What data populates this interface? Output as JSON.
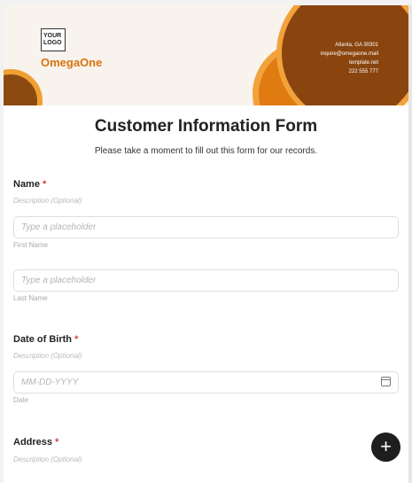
{
  "header": {
    "logo_text": "YOUR LOGO",
    "brand": "OmegaOne",
    "contact": [
      "Atlanta, GA 30301",
      "inquire@omegaone.mail",
      "template.net",
      "222 555 777"
    ]
  },
  "form": {
    "title": "Customer Information Form",
    "subtitle": "Please take a moment to fill out this form for our records.",
    "name": {
      "label": "Name",
      "required": "*",
      "description": "Description (Optional)",
      "first_placeholder": "Type a placeholder",
      "first_hint": "First Name",
      "last_placeholder": "Type a placeholder",
      "last_hint": "Last Name"
    },
    "dob": {
      "label": "Date of Birth",
      "required": "*",
      "description": "Description (Optional)",
      "placeholder": "MM-DD-YYYY",
      "hint": "Date"
    },
    "address": {
      "label": "Address",
      "required": "*",
      "description": "Description (Optional)"
    }
  },
  "fab": {
    "icon": "plus-icon",
    "glyph": "+"
  },
  "colors": {
    "accent": "#d9730d",
    "brown": "#8a450f",
    "orange": "#e07b12",
    "required": "#e03b3b"
  }
}
